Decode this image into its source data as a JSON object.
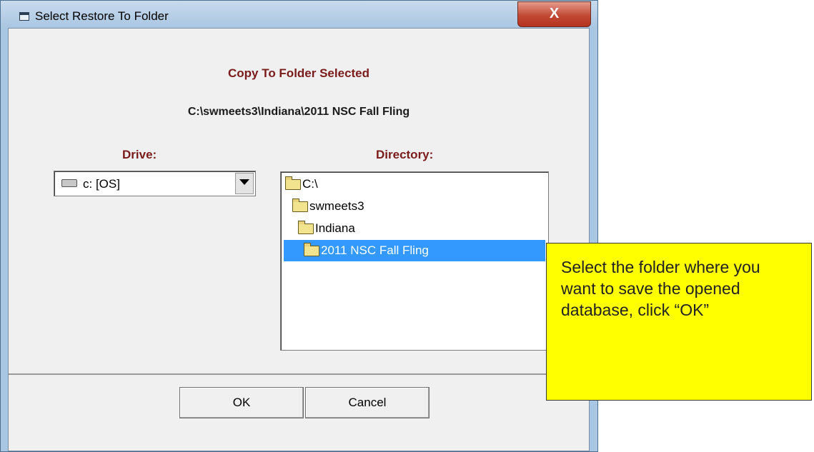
{
  "window": {
    "title": "Select Restore To Folder",
    "close_label": "X"
  },
  "dialog": {
    "heading": "Copy To Folder Selected",
    "selected_path": "C:\\swmeets3\\Indiana\\2011 NSC Fall Fling",
    "drive_label": "Drive:",
    "directory_label": "Directory:",
    "drive_value": "c: [OS]",
    "directory_items": [
      {
        "label": "C:\\",
        "selected": false
      },
      {
        "label": "swmeets3",
        "selected": false
      },
      {
        "label": "Indiana",
        "selected": false
      },
      {
        "label": "2011 NSC Fall Fling",
        "selected": true
      }
    ],
    "ok_label": "OK",
    "cancel_label": "Cancel"
  },
  "callout": {
    "text": "Select the folder where you want to save the opened database, click “OK”"
  },
  "colors": {
    "heading": "#7a1b1b",
    "selection": "#3399ff",
    "callout_bg": "#ffff00"
  }
}
